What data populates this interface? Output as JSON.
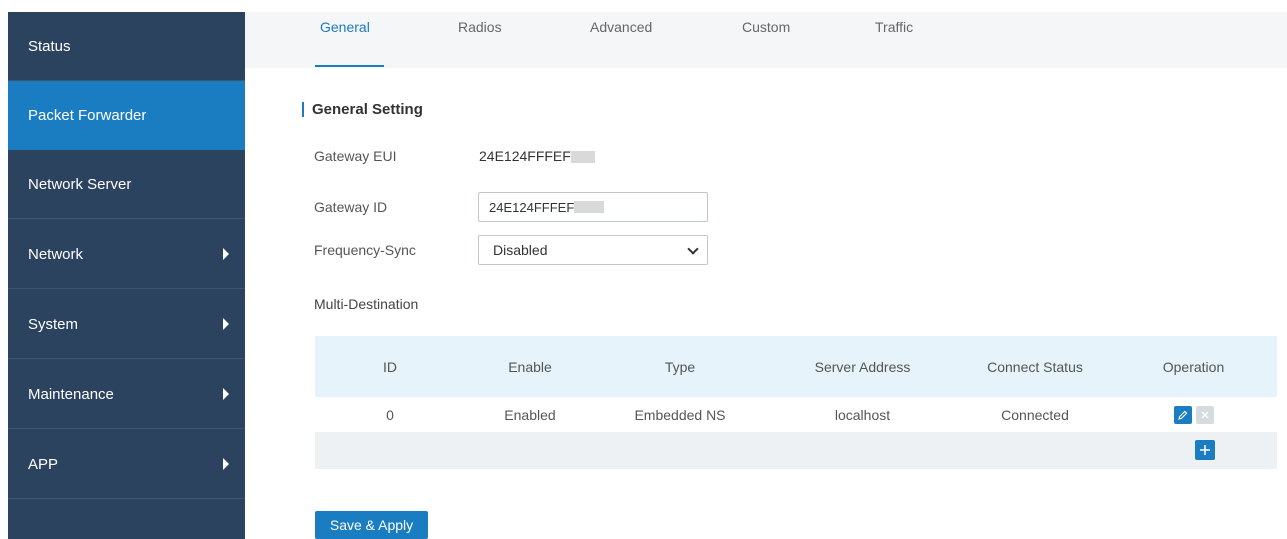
{
  "sidebar": {
    "items": [
      {
        "label": "Status",
        "active": false,
        "has_submenu": false
      },
      {
        "label": "Packet Forwarder",
        "active": true,
        "has_submenu": false
      },
      {
        "label": "Network Server",
        "active": false,
        "has_submenu": false
      },
      {
        "label": "Network",
        "active": false,
        "has_submenu": true
      },
      {
        "label": "System",
        "active": false,
        "has_submenu": true
      },
      {
        "label": "Maintenance",
        "active": false,
        "has_submenu": true
      },
      {
        "label": "APP",
        "active": false,
        "has_submenu": true
      }
    ]
  },
  "tabs": [
    {
      "label": "General",
      "active": true
    },
    {
      "label": "Radios",
      "active": false
    },
    {
      "label": "Advanced",
      "active": false
    },
    {
      "label": "Custom",
      "active": false
    },
    {
      "label": "Traffic",
      "active": false
    }
  ],
  "general": {
    "section_title": "General Setting",
    "gateway_eui_label": "Gateway EUI",
    "gateway_eui_value": "24E124FFFEF",
    "gateway_id_label": "Gateway ID",
    "gateway_id_value": "24E124FFFEF",
    "frequency_sync_label": "Frequency-Sync",
    "frequency_sync_value": "Disabled",
    "multi_destination_label": "Multi-Destination"
  },
  "table": {
    "headers": [
      "ID",
      "Enable",
      "Type",
      "Server Address",
      "Connect Status",
      "Operation"
    ],
    "rows": [
      {
        "id": "0",
        "enable": "Enabled",
        "type": "Embedded NS",
        "server_address": "localhost",
        "connect_status": "Connected"
      }
    ]
  },
  "actions": {
    "save_label": "Save & Apply"
  },
  "colors": {
    "sidebar_bg": "#2c4360",
    "active_blue": "#1a7cc1",
    "table_header_bg": "#e6f3fb"
  },
  "icons": {
    "edit": "pencil-icon",
    "delete": "close-icon",
    "add": "plus-icon",
    "submenu": "caret-right-icon"
  }
}
